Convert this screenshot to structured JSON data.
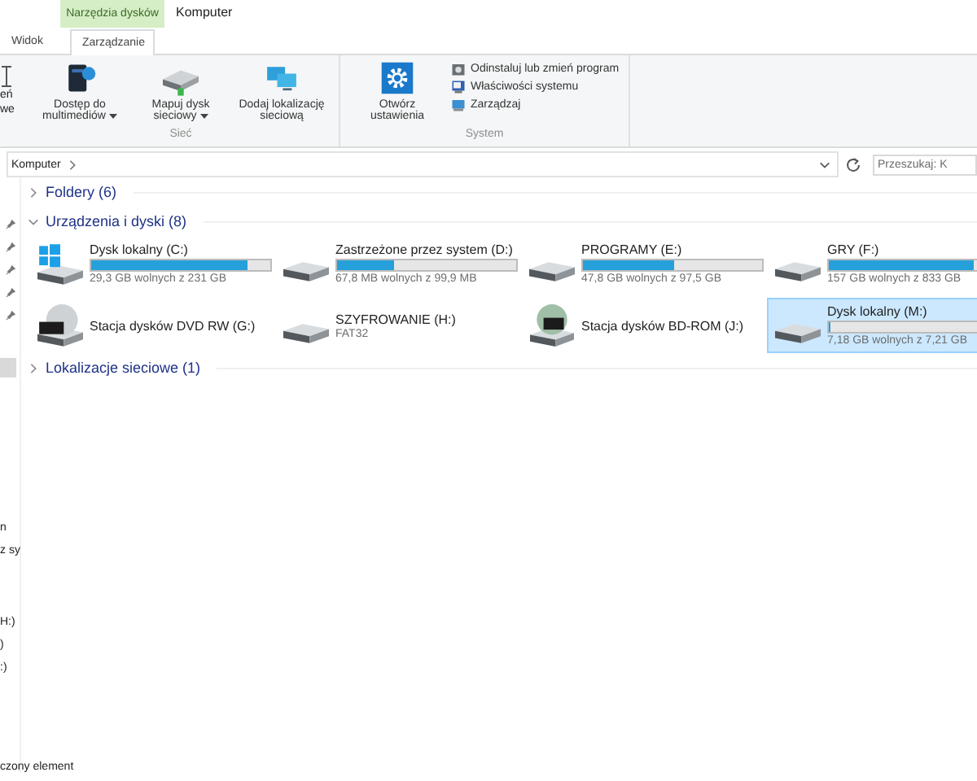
{
  "ribbon_tabs": {
    "context_header": "Narzędzia dysków",
    "window_title": "Komputer",
    "tabs": [
      {
        "label": "Widok",
        "selected": false
      },
      {
        "label": "Zarządzanie",
        "selected": true
      }
    ]
  },
  "ribbon": {
    "cut_button": [
      "eń",
      "we"
    ],
    "groups": [
      {
        "label": "Sieć",
        "buttons": [
          {
            "kind": "media",
            "label": "Dostęp do multimediów",
            "dropdown": true
          },
          {
            "kind": "map",
            "label": "Mapuj dysk sieciowy",
            "dropdown": true
          },
          {
            "kind": "netloc",
            "label": "Dodaj lokalizację sieciową",
            "dropdown": false
          }
        ]
      },
      {
        "label": "System",
        "buttons": [
          {
            "kind": "settings",
            "label": "Otwórz ustawienia",
            "dropdown": false
          }
        ],
        "small": [
          {
            "kind": "uninstall",
            "label": "Odinstaluj lub zmień program"
          },
          {
            "kind": "sysprops",
            "label": "Właściwości systemu"
          },
          {
            "kind": "manage",
            "label": "Zarządzaj"
          }
        ]
      }
    ]
  },
  "address_bar": {
    "path": "Komputer",
    "search_placeholder": "Przeszukaj: K"
  },
  "nav_pane": {
    "fragments_top": [
      "n",
      "z sy"
    ],
    "fragments_bottom": [
      "H:)",
      ")",
      ":)"
    ]
  },
  "groups": [
    {
      "title": "Foldery (6)",
      "expanded": false
    },
    {
      "title": "Urządzenia i dyski (8)",
      "expanded": true,
      "items": [
        {
          "kind": "system",
          "name": "Dysk lokalny (C:)",
          "level": 0.87,
          "info": "29,3 GB wolnych z 231 GB",
          "selected": false
        },
        {
          "kind": "hdd",
          "name": "Zastrzeżone przez system (D:)",
          "level": 0.32,
          "info": "67,8 MB wolnych z 99,9 MB",
          "selected": false
        },
        {
          "kind": "hdd",
          "name": "PROGRAMY (E:)",
          "level": 0.51,
          "info": "47,8 GB wolnych z 97,5 GB",
          "selected": false
        },
        {
          "kind": "hdd",
          "name": "GRY (F:)",
          "level": 0.81,
          "info": "157 GB wolnych z 833 GB",
          "selected": false
        },
        {
          "kind": "dvd",
          "name": "Stacja dysków DVD RW (G:)",
          "selected": false
        },
        {
          "kind": "hdd",
          "name": "SZYFROWANIE (H:)",
          "info": "FAT32",
          "selected": false
        },
        {
          "kind": "bd",
          "name": "Stacja dysków BD-ROM (J:)",
          "selected": false
        },
        {
          "kind": "hdd",
          "name": "Dysk lokalny (M:)",
          "level": 0.01,
          "info": "7,18 GB wolnych z 7,21 GB",
          "selected": true
        }
      ]
    },
    {
      "title": "Lokalizacje sieciowe (1)",
      "expanded": false
    }
  ],
  "status_bar": {
    "text": "czony element"
  }
}
